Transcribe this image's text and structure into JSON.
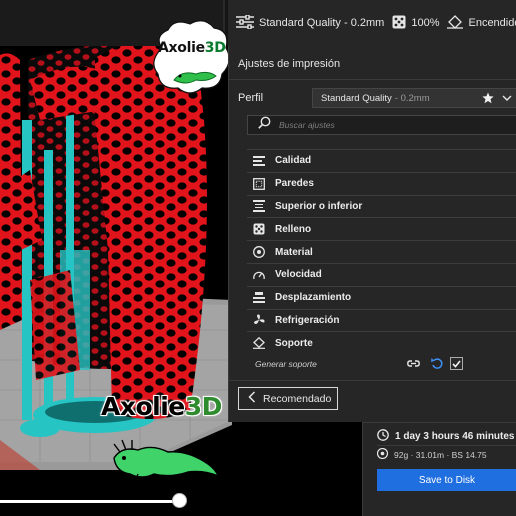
{
  "app": {
    "accent_color": "#1f6fe0"
  },
  "topbar": {
    "print_settings_icon": "sliders-icon",
    "quality_label": "Standard Quality - 0.2mm",
    "infill_icon": "infill-dice-icon",
    "infill_value": "100%",
    "adhesion_icon": "adhesion-icon",
    "adhesion_label": "Encendido"
  },
  "branding": {
    "logo_text_a": "Axolie",
    "logo_text_b": "3D",
    "watermark_text_a": "Axolie",
    "watermark_text_b": "3D"
  },
  "panel": {
    "title": "Ajustes de impresión",
    "profile_label": "Perfil",
    "profile_name": "Standard Quality",
    "profile_suffix": "- 0.2mm",
    "search_placeholder": "Buscar ajustes",
    "categories": [
      {
        "label": "Calidad",
        "icon": "quality-icon"
      },
      {
        "label": "Paredes",
        "icon": "walls-icon"
      },
      {
        "label": "Superior o inferior",
        "icon": "top-bottom-icon"
      },
      {
        "label": "Relleno",
        "icon": "infill-icon"
      },
      {
        "label": "Material",
        "icon": "material-icon"
      },
      {
        "label": "Velocidad",
        "icon": "speed-icon"
      },
      {
        "label": "Desplazamiento",
        "icon": "travel-icon"
      },
      {
        "label": "Refrigeración",
        "icon": "cooling-icon"
      },
      {
        "label": "Soporte",
        "icon": "support-icon"
      }
    ],
    "support_setting_label": "Generar soporte",
    "support_enabled": true,
    "recommended_button": "Recomendado"
  },
  "job": {
    "print_time": "1 day 3 hours 46 minutes",
    "material_info": "92g · 31.01m · BS 14.75",
    "save_button": "Save to Disk"
  },
  "layer_slider": {
    "position_fraction": 0.35
  }
}
